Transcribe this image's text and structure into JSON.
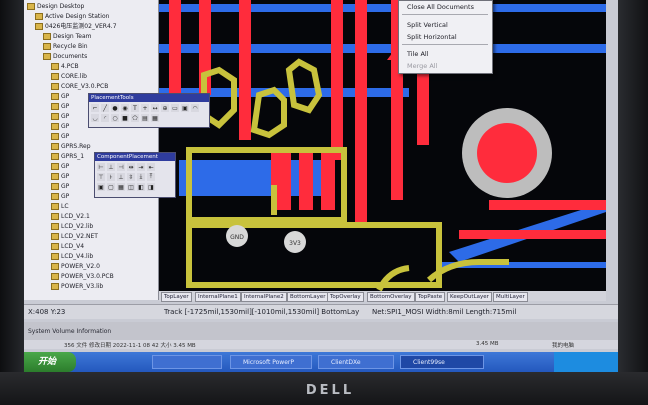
{
  "tree": {
    "items": [
      {
        "label": "Design Desktop",
        "indent": 0
      },
      {
        "label": "Active Design Station",
        "indent": 1
      },
      {
        "label": "0426电压监测02_VER4.7",
        "indent": 1
      },
      {
        "label": "Design Team",
        "indent": 2
      },
      {
        "label": "Recycle Bin",
        "indent": 2
      },
      {
        "label": "Documents",
        "indent": 2
      },
      {
        "label": "4.PCB",
        "indent": 3
      },
      {
        "label": "CORE.lib",
        "indent": 3
      },
      {
        "label": "CORE_V3.0.PCB",
        "indent": 3
      },
      {
        "label": "GP",
        "indent": 3
      },
      {
        "label": "GP",
        "indent": 3
      },
      {
        "label": "GP",
        "indent": 3
      },
      {
        "label": "GP",
        "indent": 3
      },
      {
        "label": "GP",
        "indent": 3
      },
      {
        "label": "GPRS.Rep",
        "indent": 3
      },
      {
        "label": "GPRS_1",
        "indent": 3
      },
      {
        "label": "GP",
        "indent": 3
      },
      {
        "label": "GP",
        "indent": 3
      },
      {
        "label": "GP",
        "indent": 3
      },
      {
        "label": "GP",
        "indent": 3
      },
      {
        "label": "LC",
        "indent": 3
      },
      {
        "label": "LCD_V2.1",
        "indent": 3
      },
      {
        "label": "LCD_V2.lib",
        "indent": 3
      },
      {
        "label": "LCD_V2.NET",
        "indent": 3
      },
      {
        "label": "LCD_V4",
        "indent": 3
      },
      {
        "label": "LCD_V4.lib",
        "indent": 3
      },
      {
        "label": "POWER_V2.0",
        "indent": 3
      },
      {
        "label": "POWER_V3.0.PCB",
        "indent": 3
      },
      {
        "label": "POWER_V3.lib",
        "indent": 3
      }
    ]
  },
  "context_menu": {
    "items": [
      {
        "label": "Close All Documents",
        "enabled": true
      },
      {
        "label": "Split Vertical",
        "enabled": true
      },
      {
        "label": "Split Horizontal",
        "enabled": true
      },
      {
        "label": "Tile All",
        "enabled": true
      },
      {
        "label": "Merge All",
        "enabled": false
      }
    ]
  },
  "toolbars": {
    "placement_title": "PlacementTools",
    "component_title": "ComponentPlacement"
  },
  "pads": {
    "gnd_label": "GND",
    "v_label": "3V3"
  },
  "layer_tabs": [
    "TopLayer",
    "InternalPlane1",
    "InternalPlane2",
    "BottomLayer",
    "TopOverlay",
    "BottomOverlay",
    "TopPaste",
    "KeepOutLayer",
    "MultiLayer"
  ],
  "status": {
    "coords": "X:408 Y:23",
    "track": "Track [-1725mil,1530mil][-1010mil,1530mil]   BottomLay",
    "net": "Net:SPI1_MOSI Width:8mil Length:715mil"
  },
  "system_info": "System Volume Information",
  "bottom_line": {
    "left": "356 文件 修改日期  2022-11-1 08 42 大小 3.45 MB",
    "size": "3.45 MB",
    "right": "我的电脑"
  },
  "taskbar": {
    "start_label": "开始",
    "tasks": [
      "",
      "Microsoft PowerP",
      "ClientDXe",
      "Client99se"
    ]
  },
  "colors": {
    "top_layer": "#ff2c3c",
    "bottom_layer": "#2d6be8",
    "overlay": "#c8c23c",
    "pad_gray": "#bdbdbd",
    "background": "#05060a"
  },
  "monitor": {
    "brand": "DELL"
  }
}
